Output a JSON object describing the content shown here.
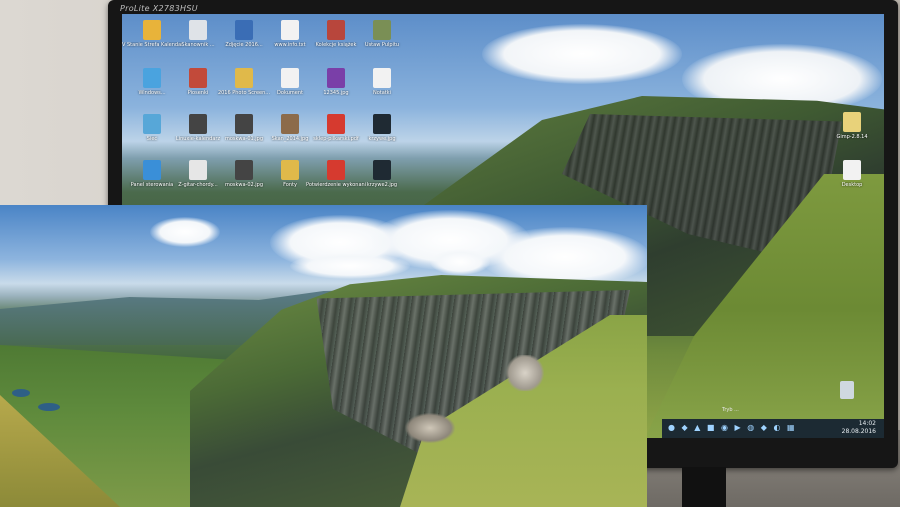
{
  "monitor": {
    "brand": "ProLite X2783HSU"
  },
  "desktop_icons": [
    {
      "label": "V Stanie Strefa Kalendarz...",
      "color": "#e8b33a"
    },
    {
      "label": "Skanownik ...",
      "color": "#dfe3e8"
    },
    {
      "label": "Zdjęcie 2016...",
      "color": "#3a6db5"
    },
    {
      "label": "www.info.txt",
      "color": "#f2f2f2"
    },
    {
      "label": "Kolekcje książek",
      "color": "#b8463c"
    },
    {
      "label": "Ustaw Pulpitu",
      "color": "#7a8f55"
    },
    {
      "label": "Windows...",
      "color": "#4aa3df"
    },
    {
      "label": "Piosenki",
      "color": "#c24a3a"
    },
    {
      "label": "2016 Photo Screen...",
      "color": "#e0b94a"
    },
    {
      "label": "Dokument",
      "color": "#f2f2f2"
    },
    {
      "label": "12345.jpg",
      "color": "#7a3fa8"
    },
    {
      "label": "Notatki",
      "color": "#f2f2f2"
    },
    {
      "label": "Sieć",
      "color": "#57a7d8"
    },
    {
      "label": "Linuxie-kalendarz",
      "color": "#444444"
    },
    {
      "label": "moskwa-01.jpg",
      "color": "#444444"
    },
    {
      "label": "Skan_2014.jpg",
      "color": "#8c6b4a"
    },
    {
      "label": "sklep-pilkarski.pdf",
      "color": "#d63a2f"
    },
    {
      "label": "krzywe.jpg",
      "color": "#1f2a33"
    },
    {
      "label": "Panel sterowania",
      "color": "#3a8fd8"
    },
    {
      "label": "Z-gitar-chordy...",
      "color": "#e6e6e6"
    },
    {
      "label": "moskwa-02.jpg",
      "color": "#444444"
    },
    {
      "label": "Fonty",
      "color": "#e0b94a"
    },
    {
      "label": "Potwierdzenie wykonania",
      "color": "#d63a2f"
    },
    {
      "label": "krzywe2.jpg",
      "color": "#1f2a33"
    },
    {
      "label": "Gimp-2.8.14",
      "color": "#e8d27a"
    },
    {
      "label": "Desktop",
      "color": "#f2f2f2"
    }
  ],
  "taskbar": {
    "time": "14:02",
    "date": "28.08.2016",
    "notice": "Tryb ...",
    "tray_icons": "● ◆ ▲ ■ ◉ ▶ ◍ ◆ ◐ ▦"
  }
}
